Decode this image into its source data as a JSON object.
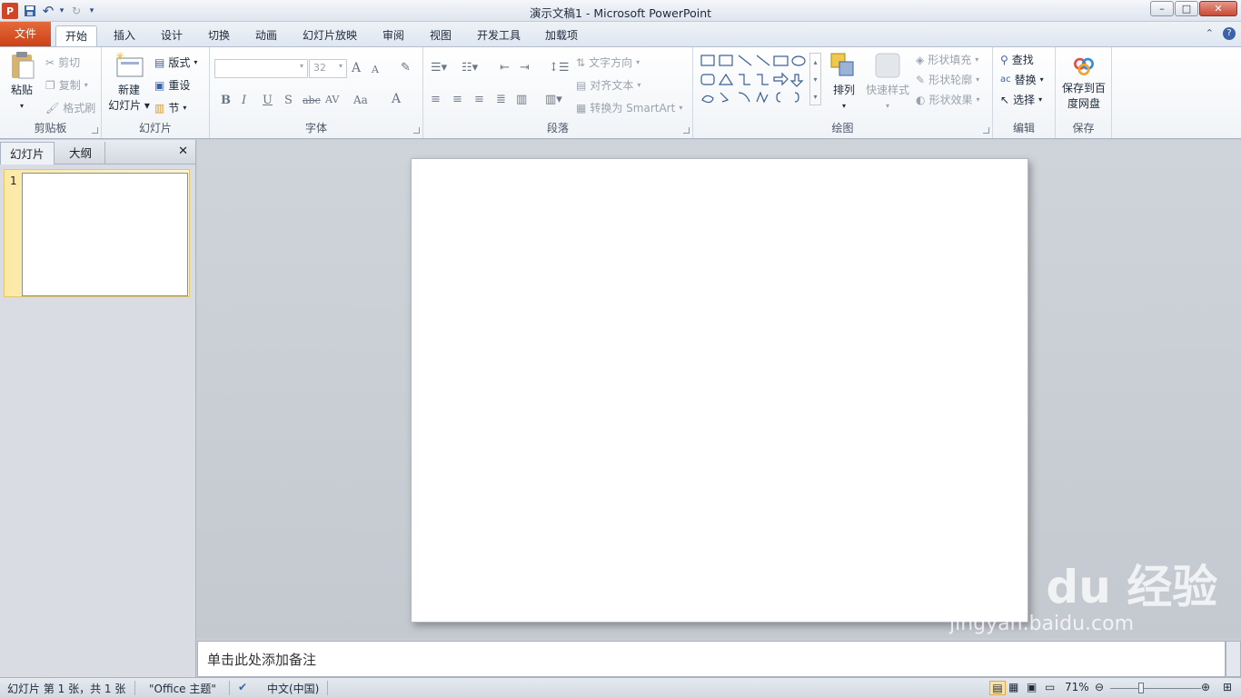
{
  "window": {
    "title": "演示文稿1  -  Microsoft PowerPoint",
    "minimize": "–",
    "maximize": "□",
    "close": "✕"
  },
  "qat": {
    "app": "P",
    "save": "💾",
    "undo": "↶",
    "redo": "↻",
    "customize": "▾"
  },
  "tabs": [
    "文件",
    "开始",
    "插入",
    "设计",
    "切换",
    "动画",
    "幻灯片放映",
    "审阅",
    "视图",
    "开发工具",
    "加载项"
  ],
  "ribbon_right": {
    "minimize": "⌃",
    "help": "?"
  },
  "groups": {
    "clipboard": {
      "label": "剪贴板",
      "paste": "粘贴",
      "cut": "剪切",
      "copy": "复制",
      "format_painter": "格式刷"
    },
    "slides": {
      "label": "幻灯片",
      "new_slide_line1": "新建",
      "new_slide_line2": "幻灯片",
      "layout": "版式",
      "reset": "重设",
      "section": "节"
    },
    "font": {
      "label": "字体",
      "font_name": "",
      "font_size": "32",
      "bold": "B",
      "italic": "I",
      "underline": "U",
      "shadow": "S",
      "strike": "abc",
      "spacing": "AV",
      "case": "Aa",
      "grow": "A",
      "shrink": "A",
      "color": "A"
    },
    "paragraph": {
      "label": "段落",
      "text_direction": "文字方向",
      "align_text": "对齐文本",
      "smartart": "转换为 SmartArt"
    },
    "drawing": {
      "label": "绘图",
      "arrange": "排列",
      "quick_styles": "快速样式",
      "fill": "形状填充",
      "outline": "形状轮廓",
      "effects": "形状效果"
    },
    "editing": {
      "label": "编辑",
      "find": "查找",
      "replace": "替换",
      "select": "选择"
    },
    "save": {
      "label": "保存",
      "baidu_line1": "保存到百",
      "baidu_line2": "度网盘"
    }
  },
  "panel": {
    "tab_slides": "幻灯片",
    "tab_outline": "大纲",
    "close": "✕",
    "slide_number": "1"
  },
  "notes": {
    "placeholder": "单击此处添加备注"
  },
  "status": {
    "slide_info": "幻灯片 第 1 张，共 1 张",
    "theme": "\"Office 主题\"",
    "language": "中文(中国)",
    "zoom": "71%",
    "zoom_level_percent": 71
  },
  "watermark": {
    "brand": "Bai du 经验",
    "url": "jingyan.baidu.com"
  }
}
